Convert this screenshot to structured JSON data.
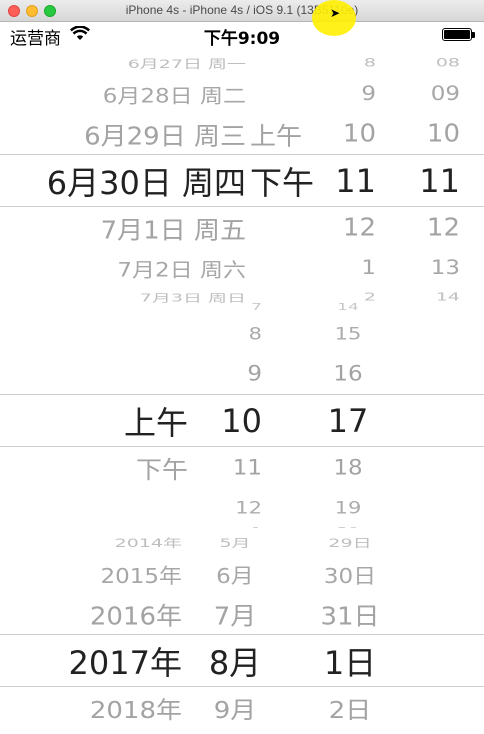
{
  "window": {
    "title": "iPhone 4s - iPhone 4s / iOS 9.1 (13B5110e)"
  },
  "status_bar": {
    "carrier": "运营商",
    "time": "下午9:09"
  },
  "picker_datetime": {
    "date_col": [
      "6月27日 周一",
      "6月28日 周二",
      "6月29日 周三",
      "6月30日 周四",
      "7月1日 周五",
      "7月2日 周六",
      "7月3日 周日"
    ],
    "ampm_col": [
      "",
      "",
      "上午",
      "下午",
      "",
      "",
      ""
    ],
    "hour_col": [
      "8",
      "9",
      "10",
      "11",
      "12",
      "1",
      "2"
    ],
    "minute_col": [
      "08",
      "09",
      "10",
      "11",
      "12",
      "13",
      "14"
    ],
    "selected_index": 3
  },
  "picker_time": {
    "ampm_col": [
      "",
      "",
      "上午",
      "下午",
      ""
    ],
    "hour_col": [
      "7",
      "8",
      "9",
      "10",
      "11",
      "12",
      "1"
    ],
    "minute_col": [
      "14",
      "15",
      "16",
      "17",
      "18",
      "19",
      "20"
    ],
    "selected_index": 3
  },
  "picker_date": {
    "year_col": [
      "2014年",
      "2015年",
      "2016年",
      "2017年",
      "2018年"
    ],
    "month_col": [
      "5月",
      "6月",
      "7月",
      "8月",
      "9月"
    ],
    "day_col": [
      "29日",
      "30日",
      "31日",
      "1日",
      "2日"
    ],
    "selected_index": 3
  },
  "colors": {
    "selected_text": "#222222",
    "unselected_text": "#a3a3a3",
    "separator": "#cfcfcf"
  }
}
